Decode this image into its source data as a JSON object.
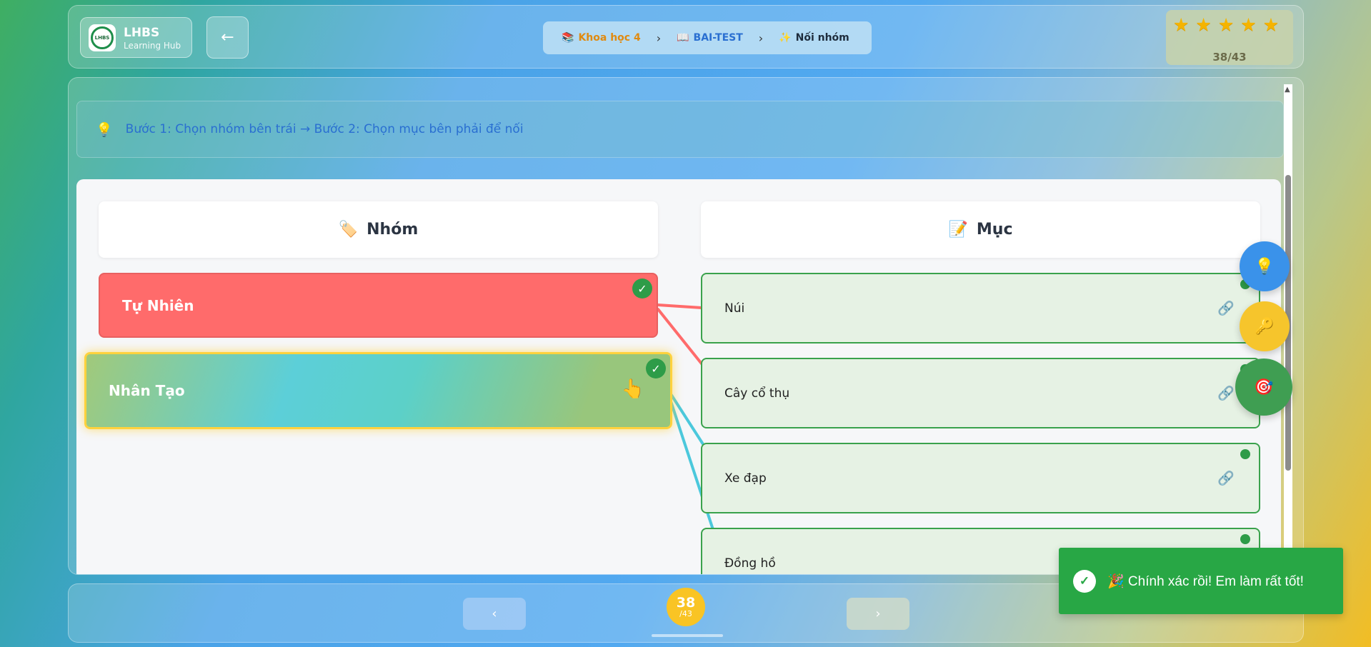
{
  "header": {
    "logo_title": "LHBS",
    "logo_sub": "Learning Hub",
    "logo_mark": "LHBS",
    "back_icon": "←",
    "breadcrumb": [
      {
        "icon": "📚",
        "label": "Khoa học 4"
      },
      {
        "icon": "📖",
        "label": "BAI-TEST"
      },
      {
        "icon": "✨",
        "label": "Nối nhóm"
      }
    ],
    "separator": "›",
    "stars": 5,
    "progress": "38/43"
  },
  "instruction": {
    "icon": "💡",
    "text": "Bước 1: Chọn nhóm bên trái → Bước 2: Chọn mục bên phải để nối"
  },
  "columns": {
    "left": {
      "icon": "🏷️",
      "title": "Nhóm"
    },
    "right": {
      "icon": "📝",
      "title": "Mục"
    }
  },
  "groups": [
    {
      "label": "Tự Nhiên",
      "color": "#ff6b6b",
      "matched": true
    },
    {
      "label": "Nhân Tạo",
      "selected": true,
      "matched": true
    }
  ],
  "items": [
    {
      "label": "Núi",
      "group": "Tự Nhiên"
    },
    {
      "label": "Cây cổ thụ",
      "group": "Tự Nhiên"
    },
    {
      "label": "Xe đạp",
      "group": "Nhân Tạo"
    },
    {
      "label": "Đồng hồ",
      "group": "Nhân Tạo"
    }
  ],
  "link_colors": {
    "Tự Nhiên": "#ff6b6b",
    "Nhân Tạo": "#4bc8dc"
  },
  "fabs": {
    "hint": "💡",
    "key": "🔑",
    "target": "🎯"
  },
  "footer": {
    "prev": "‹",
    "next": "›",
    "page": "38",
    "total": "/43"
  },
  "toast": {
    "check": "✓",
    "text": "🎉 Chính xác rồi! Em làm rất tốt!"
  }
}
